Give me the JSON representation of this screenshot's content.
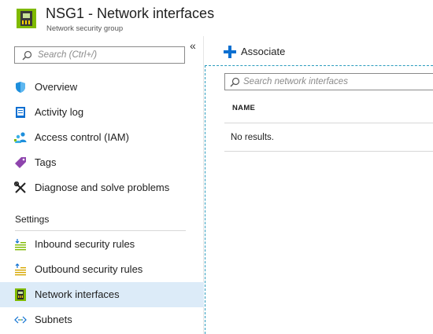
{
  "header": {
    "title": "NSG1 - Network interfaces",
    "subtitle": "Network security group"
  },
  "sidebar": {
    "search": {
      "placeholder": "Search (Ctrl+/)",
      "value": ""
    },
    "collapse_glyph": "«",
    "items": [
      {
        "label": "Overview",
        "icon": "shield-icon"
      },
      {
        "label": "Activity log",
        "icon": "activity-log-icon"
      },
      {
        "label": "Access control (IAM)",
        "icon": "people-icon"
      },
      {
        "label": "Tags",
        "icon": "tag-icon"
      },
      {
        "label": "Diagnose and solve problems",
        "icon": "wrench-icon"
      }
    ],
    "section": "Settings",
    "settings_items": [
      {
        "label": "Inbound security rules",
        "icon": "inbound-rules-icon"
      },
      {
        "label": "Outbound security rules",
        "icon": "outbound-rules-icon"
      },
      {
        "label": "Network interfaces",
        "icon": "network-interface-icon",
        "active": true
      },
      {
        "label": "Subnets",
        "icon": "subnet-icon"
      }
    ]
  },
  "main": {
    "associate_label": "Associate",
    "search": {
      "placeholder": "Search network interfaces",
      "value": ""
    },
    "table": {
      "columns": [
        "NAME"
      ],
      "rows": [],
      "empty_text": "No results."
    }
  },
  "colors": {
    "accent": "#0b6fd1",
    "active_bg": "#dcebf8",
    "dashed_border": "#2a9bbd",
    "nic_green": "#7fba00"
  }
}
